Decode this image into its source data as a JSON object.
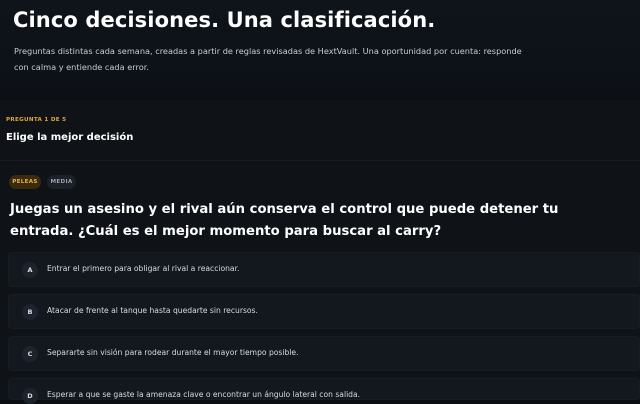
{
  "hero": {
    "title": "Cinco decisiones. Una clasificación.",
    "subtitle": "Preguntas distintas cada semana, creadas a partir de reglas revisadas de HextVault. Una oportunidad por cuenta: responde con calma y entiende cada error."
  },
  "quiz": {
    "progress_label": "PREGUNTA 1 DE 5",
    "current_question": 1,
    "total_questions": 5,
    "heading": "Elige la mejor decisión",
    "tags": {
      "category": "PELEAS",
      "difficulty": "MEDIA"
    },
    "question": "Juegas un asesino y el rival aún conserva el control que puede detener tu entrada. ¿Cuál es el mejor momento para buscar al carry?",
    "options": [
      {
        "letter": "A",
        "text": "Entrar el primero para obligar al rival a reaccionar."
      },
      {
        "letter": "B",
        "text": "Atacar de frente al tanque hasta quedarte sin recursos."
      },
      {
        "letter": "C",
        "text": "Separarte sin visión para rodear durante el mayor tiempo posible."
      },
      {
        "letter": "D",
        "text": "Esperar a que se gaste la amenaza clave o encontrar un ángulo lateral con salida."
      }
    ]
  },
  "colors": {
    "accent": "#e0a93a",
    "background": "#0b0e13",
    "panel": "#0f1318",
    "option_bg": "#13181f"
  }
}
